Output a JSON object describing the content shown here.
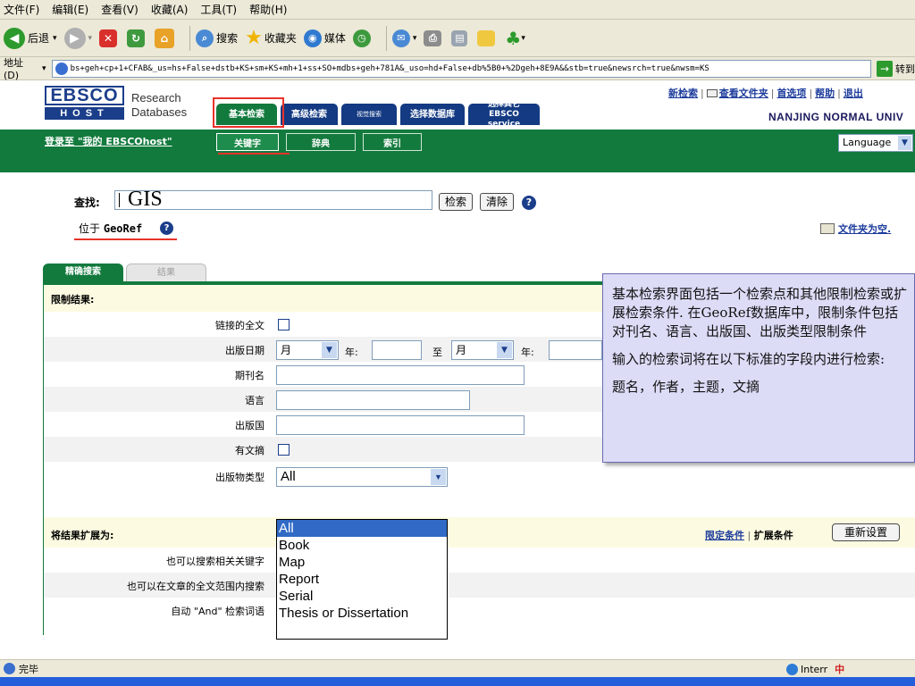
{
  "menu": [
    "文件(F)",
    "编辑(E)",
    "查看(V)",
    "收藏(A)",
    "工具(T)",
    "帮助(H)"
  ],
  "toolbar": {
    "back": "后退",
    "search": "搜索",
    "favorites": "收藏夹",
    "media": "媒体"
  },
  "address": {
    "label": "地址(D)",
    "url": "bs+geh+cp+1+CFAB&_us=hs+False+dstb+KS+sm+KS+mh+1+ss+SO+mdbs+geh+781A&_uso=hd+False+db%5B0+%2Dgeh+8E9A&&stb=true&newsrch=true&nwsm=KS",
    "go": "转到"
  },
  "header": {
    "logo_top": "EBSCO",
    "logo_bottom": "HOST",
    "logo_text_line1": "Research",
    "logo_text_line2": "Databases",
    "tabs": [
      "基本检索",
      "高级检索",
      "视觉搜索",
      "选择数据库"
    ],
    "tab_other_line1": "选择其它",
    "tab_other_line2": "EBSCO service",
    "links": [
      "新检索",
      "查看文件夹",
      "首选项",
      "帮助",
      "退出"
    ],
    "institution": "NANJING NORMAL UNIV"
  },
  "greenbar": {
    "login": "登录至 \"我的 EBSCOhost\"",
    "subtabs": [
      "关键字",
      "辞典",
      "索引"
    ],
    "language": "Language"
  },
  "search": {
    "find_label": "查找:",
    "query": "GIS",
    "search_button": "检索",
    "clear_button": "清除",
    "in_prefix": "位于",
    "database": "GeoRef",
    "folder": "文件夹为空."
  },
  "refine": {
    "tab_active": "精确搜索",
    "tab_inactive": "结果",
    "limit_title": "限制结果:",
    "fulltext_label": "链接的全文",
    "date_label": "出版日期",
    "month": "月",
    "year": "年:",
    "to": "至",
    "journal_label": "期刊名",
    "language_label": "语言",
    "country_label": "出版国",
    "abstract_label": "有文摘",
    "pubtype_label": "出版物类型",
    "pubtype_value": "All",
    "pubtype_options": [
      "All",
      "Book",
      "Map",
      "Report",
      "Serial",
      "Thesis or Dissertation"
    ],
    "expand_title": "将结果扩展为:",
    "limiters_link": "限定条件",
    "expanders_link": "扩展条件",
    "reset_button": "重新设置",
    "related_label": "也可以搜索相关关键字",
    "fulltext_search_label": "也可以在文章的全文范围内搜索",
    "auto_and_label": "自动 \"And\" 检索词语"
  },
  "callout": {
    "p1": "基本检索界面包括一个检索点和其他限制检索或扩展检索条件. 在GeoRef数据库中，限制条件包括对刊名、语言、出版国、出版类型限制条件",
    "p2": "输入的检索词将在以下标准的字段内进行检索:",
    "p3": "题名，作者，主题，文摘"
  },
  "status": {
    "text": "完毕",
    "zone": "Interr"
  },
  "colors": {
    "ebsco_blue": "#1b3e8b",
    "ebsco_green": "#137a3e",
    "highlight_red": "#e8332a",
    "callout_bg": "#dcdcf7"
  }
}
